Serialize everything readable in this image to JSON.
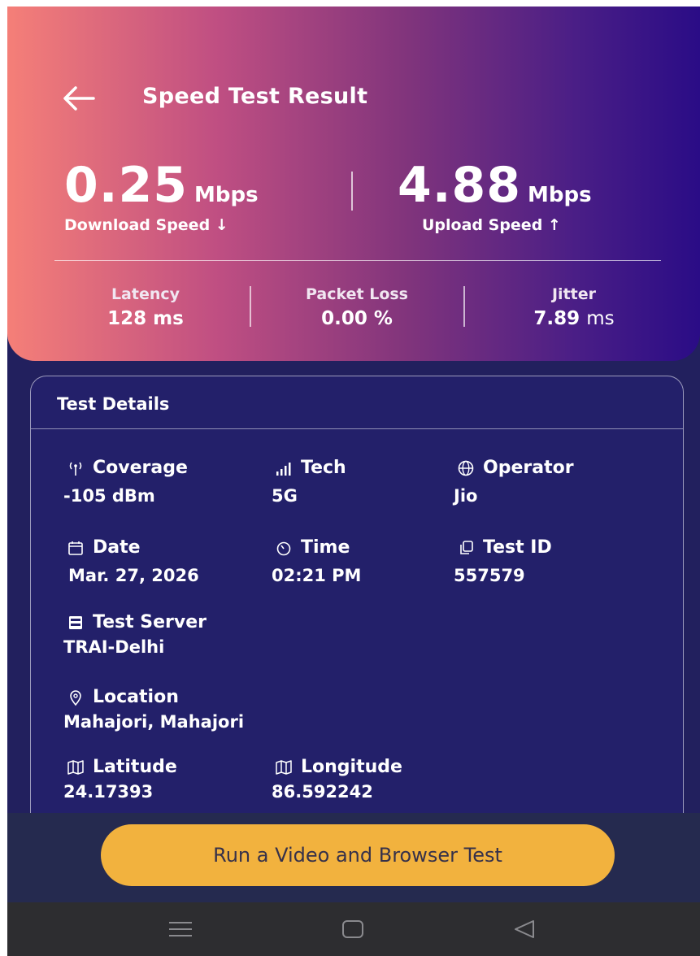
{
  "header": {
    "title": "Speed Test Result",
    "back_icon": "arrow-left-icon"
  },
  "download": {
    "value": "0.25",
    "unit": "Mbps",
    "label": "Download Speed ↓"
  },
  "upload": {
    "value": "4.88",
    "unit": "Mbps",
    "label": "Upload Speed ↑"
  },
  "metrics": {
    "latency": {
      "label": "Latency",
      "value": "128 ms"
    },
    "packet_loss": {
      "label": "Packet Loss",
      "value": "0.00 %"
    },
    "jitter": {
      "label": "Jitter",
      "value": "7.89",
      "unit": "ms"
    }
  },
  "details": {
    "title": "Test Details",
    "coverage": {
      "label": "Coverage",
      "value": "-105 dBm",
      "icon": "antenna-icon"
    },
    "tech": {
      "label": "Tech",
      "value": "5G",
      "icon": "signal-bars-icon"
    },
    "operator": {
      "label": "Operator",
      "value": "Jio",
      "icon": "globe-icon"
    },
    "date": {
      "label": "Date",
      "value": "Mar. 27, 2026",
      "icon": "calendar-icon"
    },
    "time": {
      "label": "Time",
      "value": "02:21 PM",
      "icon": "timer-icon"
    },
    "test_id": {
      "label": "Test ID",
      "value": "557579",
      "icon": "copy-icon"
    },
    "test_server": {
      "label": "Test Server",
      "value": "TRAI-Delhi",
      "icon": "server-icon"
    },
    "location": {
      "label": "Location",
      "value": "Mahajori, Mahajori",
      "icon": "location-pin-icon"
    },
    "latitude": {
      "label": "Latitude",
      "value": "24.17393",
      "icon": "map-icon"
    },
    "longitude": {
      "label": "Longitude",
      "value": "86.592242",
      "icon": "map-icon"
    }
  },
  "run_test_button": {
    "label": "Run a Video and Browser Test"
  },
  "nav": {
    "menu_icon": "menu-icon",
    "home_icon": "home-square-icon",
    "back_icon": "back-triangle-icon"
  },
  "colors": {
    "gradient_start": "#f57f78",
    "gradient_end": "#2a0c86",
    "background": "#22205e",
    "button": "#f2b23e",
    "nav_bar": "#2d2d30"
  }
}
